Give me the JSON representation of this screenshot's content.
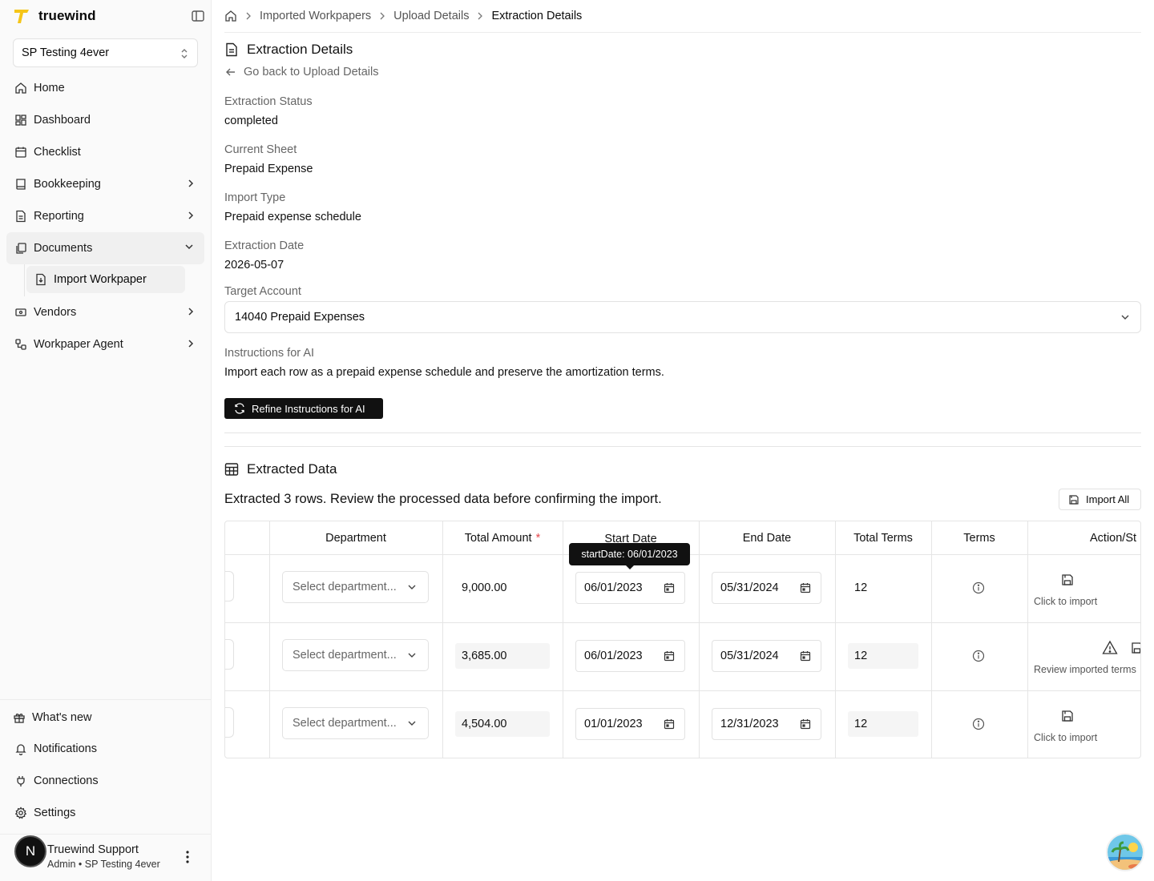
{
  "sidebar": {
    "brand": "truewind",
    "org": "SP Testing 4ever",
    "nav": [
      {
        "label": "Home",
        "icon": "home-icon"
      },
      {
        "label": "Dashboard",
        "icon": "dashboard-icon"
      },
      {
        "label": "Checklist",
        "icon": "calendar-check-icon"
      },
      {
        "label": "Bookkeeping",
        "icon": "book-icon"
      },
      {
        "label": "Reporting",
        "icon": "report-icon"
      },
      {
        "label": "Documents",
        "icon": "documents-icon"
      },
      {
        "label": "Import Workpaper",
        "icon": "file-import-icon"
      },
      {
        "label": "Vendors",
        "icon": "vendor-icon"
      },
      {
        "label": "Workpaper Agent",
        "icon": "workflow-icon"
      }
    ],
    "bottom": [
      {
        "label": "What's new",
        "icon": "gift-icon"
      },
      {
        "label": "Notifications",
        "icon": "bell-icon"
      },
      {
        "label": "Connections",
        "icon": "plug-icon"
      },
      {
        "label": "Settings",
        "icon": "gear-icon"
      }
    ],
    "user": {
      "initial": "N",
      "name": "Truewind Support",
      "role": "Admin • SP Testing 4ever"
    }
  },
  "breadcrumb": [
    "Imported Workpapers",
    "Upload Details",
    "Extraction Details"
  ],
  "details": {
    "title": "Extraction Details",
    "back_label": "Go back to Upload Details",
    "fields": [
      {
        "label": "Extraction Status",
        "value": "completed"
      },
      {
        "label": "Current Sheet",
        "value": "Prepaid Expense"
      },
      {
        "label": "Import Type",
        "value": "Prepaid expense schedule"
      },
      {
        "label": "Extraction Date",
        "value": "2026-05-07"
      }
    ],
    "target_account_label": "Target Account",
    "target_account_value": "14040 Prepaid Expenses",
    "instructions_label": "Instructions for AI",
    "instructions_value": "Import each row as a prepaid expense schedule and preserve the amortization terms.",
    "refine_button": "Refine Instructions for AI"
  },
  "extracted": {
    "title": "Extracted Data",
    "summary": "Extracted 3 rows. Review the processed data before confirming the import.",
    "import_all": "Import All",
    "columns": [
      "Department",
      "Total Amount",
      "Start Date",
      "End Date",
      "Total Terms",
      "Terms",
      "Action/St"
    ],
    "required_mark": "*",
    "tooltip": "startDate: 06/01/2023",
    "rows": [
      {
        "department": "Select department...",
        "amount": "9,000.00",
        "start": "06/01/2023",
        "end": "05/31/2024",
        "terms": "12",
        "action": "Click to import"
      },
      {
        "department": "Select department...",
        "amount": "3,685.00",
        "start": "06/01/2023",
        "end": "05/31/2024",
        "terms": "12",
        "action": "Review imported terms"
      },
      {
        "department": "Select department...",
        "amount": "4,504.00",
        "start": "01/01/2023",
        "end": "12/31/2023",
        "terms": "12",
        "action": "Click to import"
      }
    ]
  },
  "colors": {
    "accent": "#f5c518",
    "dark": "#111111",
    "required": "#e5484d"
  }
}
